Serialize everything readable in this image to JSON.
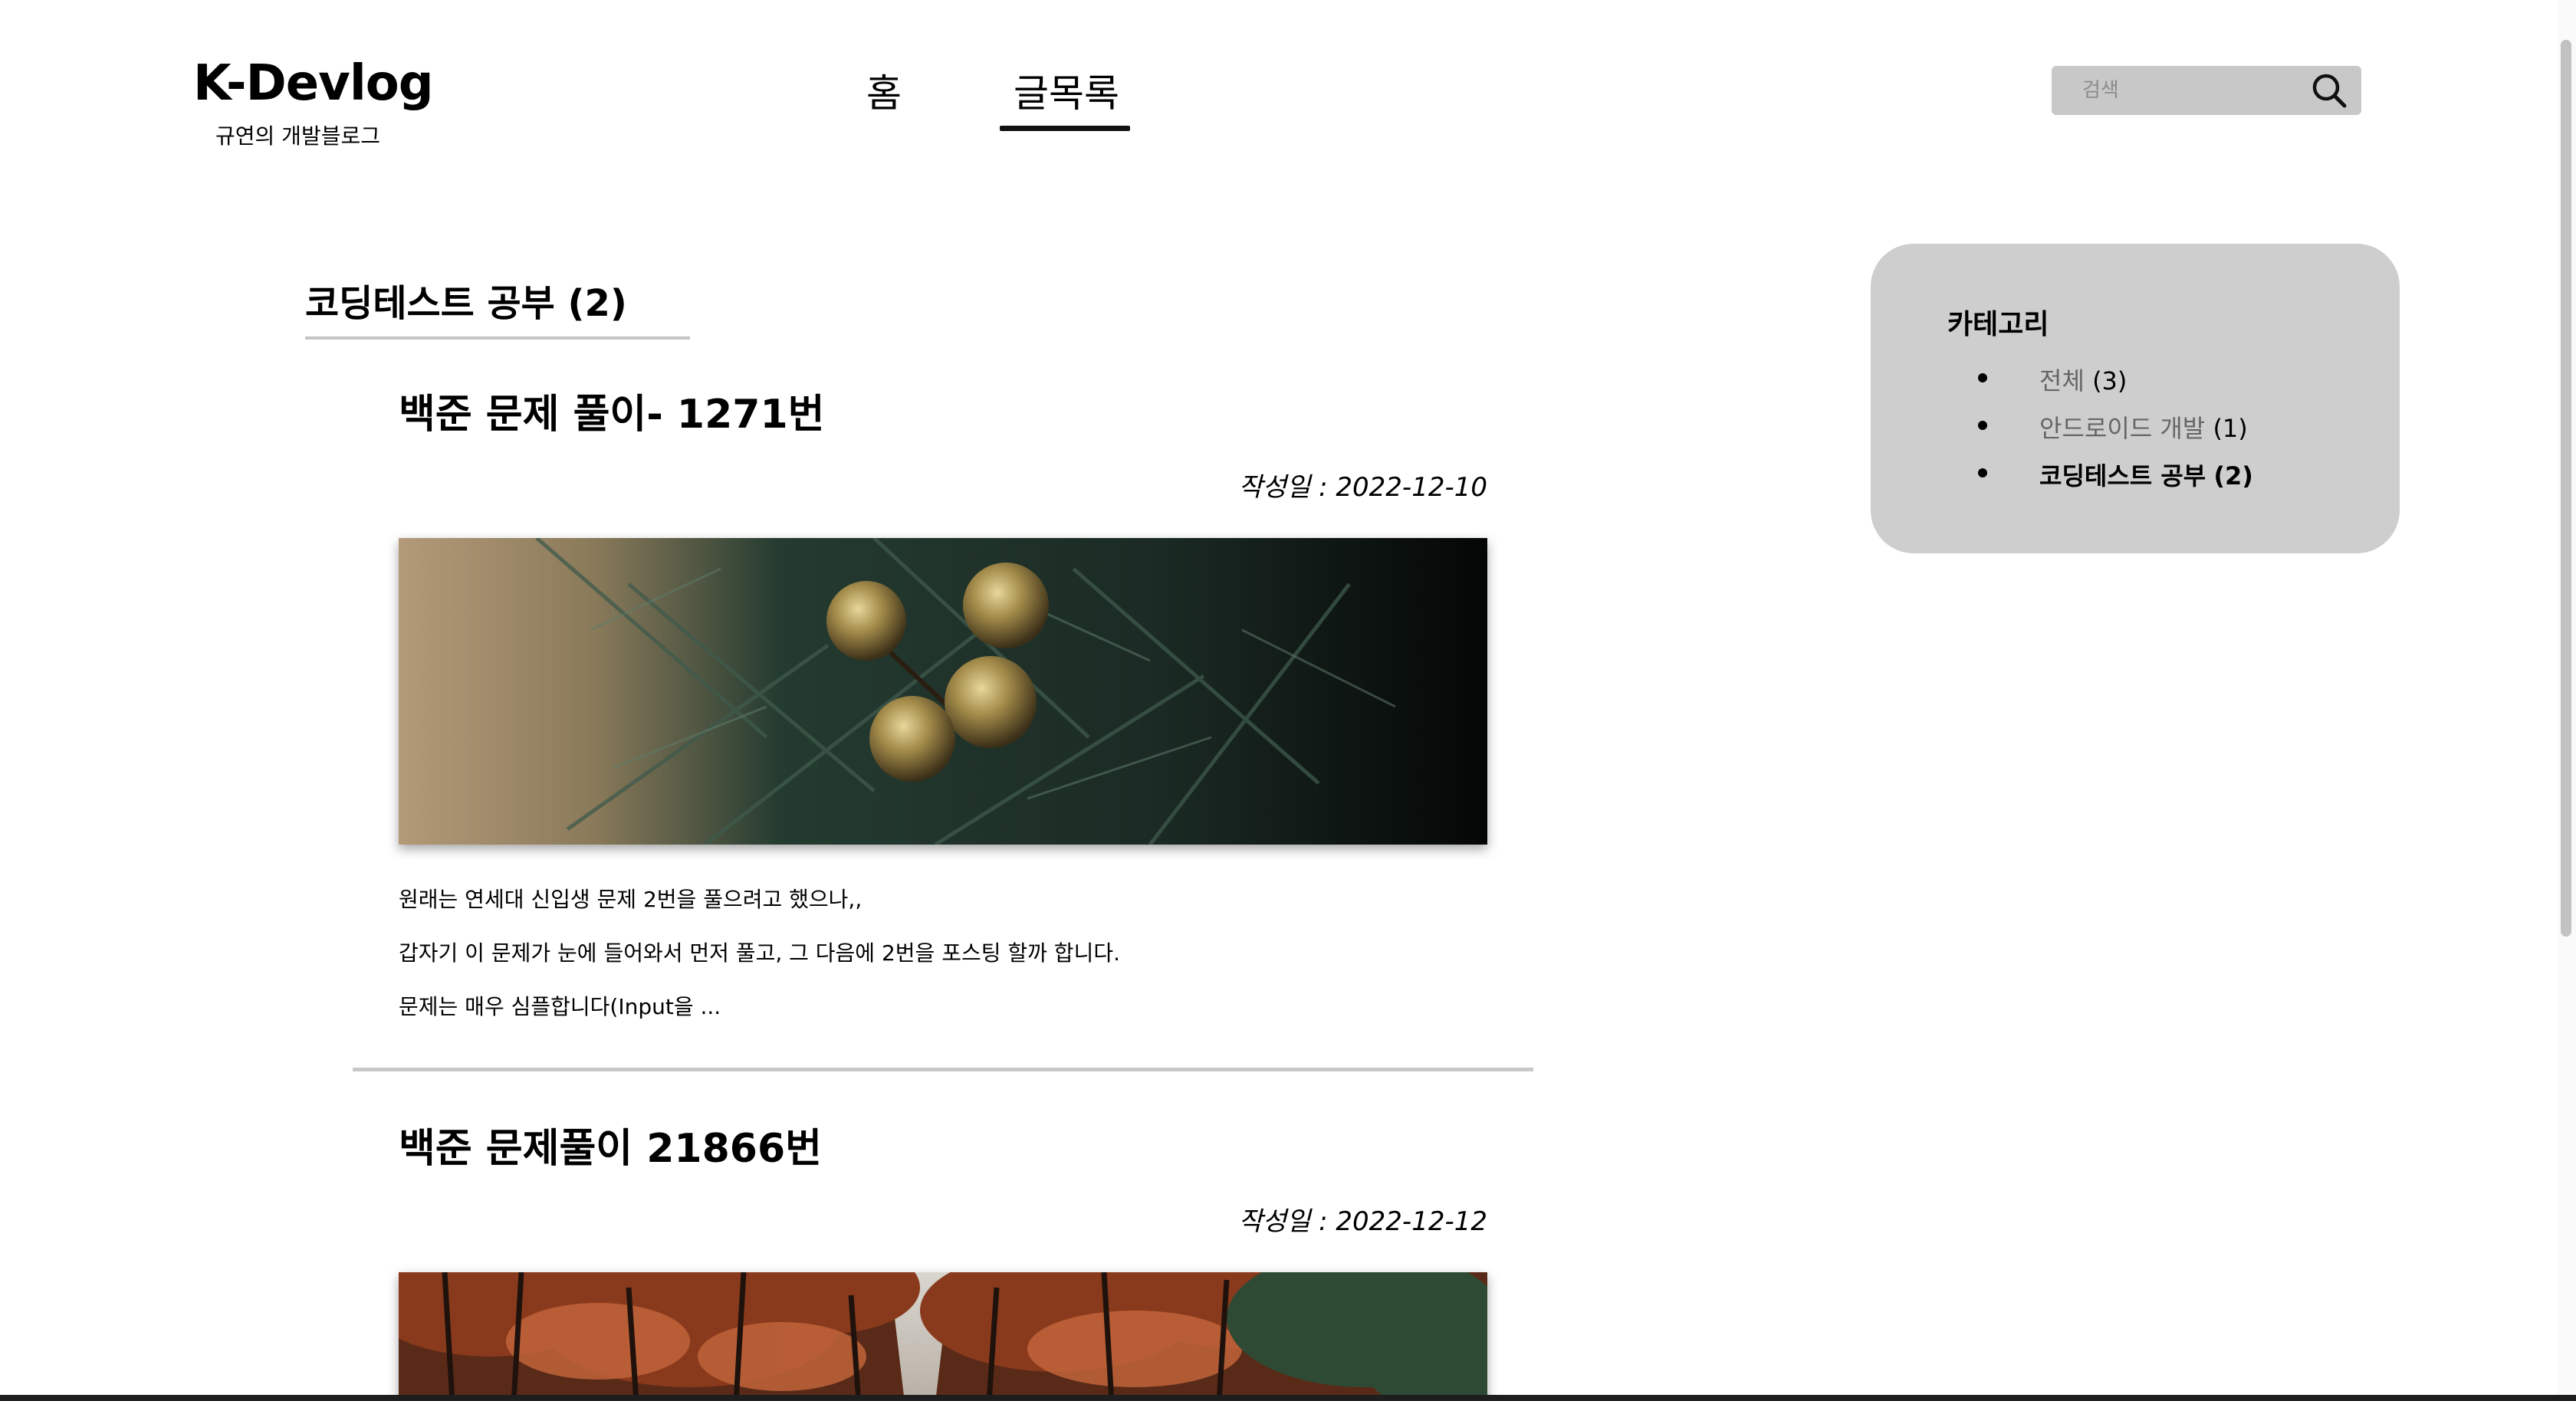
{
  "header": {
    "logo_title": "K-Devlog",
    "logo_subtitle": "규연의 개발블로그",
    "nav": [
      {
        "label": "홈",
        "active": false
      },
      {
        "label": "글목록",
        "active": true
      }
    ],
    "search": {
      "placeholder": "검색",
      "value": ""
    }
  },
  "main": {
    "category_heading": "코딩테스트 공부 (2)",
    "posts": [
      {
        "title": "백준 문제 풀이- 1271번",
        "date": "작성일 : 2022-12-10",
        "image": "christmas-ornament-photo",
        "excerpt": [
          "원래는 연세대 신입생 문제 2번을 풀으려고 했으나,,",
          "갑자기 이 문제가 눈에 들어와서 먼저 풀고, 그 다음에 2번을 포스팅 할까 합니다.",
          "문제는 매우 심플합니다(Input을 ..."
        ]
      },
      {
        "title": "백준 문제풀이 21866번",
        "date": "작성일 : 2022-12-12",
        "image": "autumn-forest-road-photo"
      }
    ]
  },
  "sidebar": {
    "title": "카테고리",
    "categories": [
      {
        "name": "전체",
        "count": "(3)",
        "active": false
      },
      {
        "name": "안드로이드 개발",
        "count": "(1)",
        "active": false
      },
      {
        "name": "코딩테스트 공부",
        "count": "(2)",
        "active": true
      }
    ]
  },
  "colors": {
    "sidebar_bg": "#cecece",
    "search_bg": "#c8c8c8",
    "divider": "#c4c4c4",
    "muted_text": "#666666"
  }
}
